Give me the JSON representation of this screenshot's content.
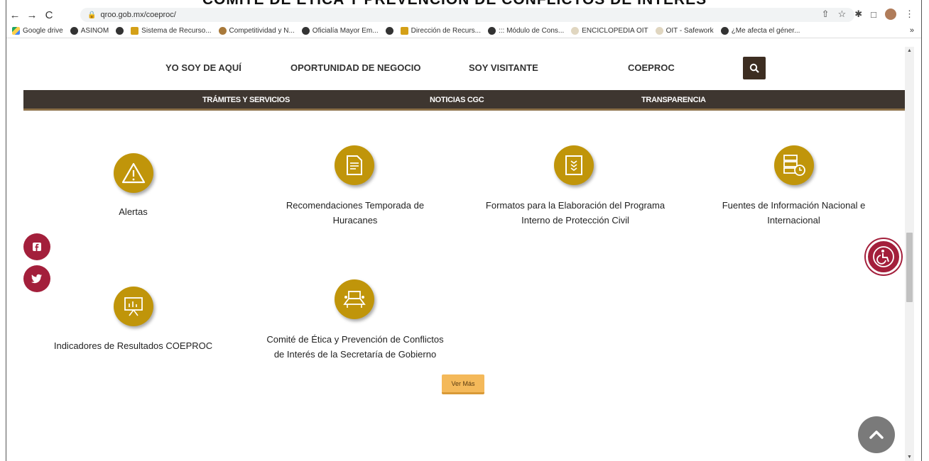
{
  "browser": {
    "url": "qroo.gob.mx/coeproc/",
    "bookmarks": [
      {
        "label": "Google drive",
        "icon": "drive"
      },
      {
        "label": "ASINOM",
        "icon": "globe"
      },
      {
        "label": "",
        "icon": "globe"
      },
      {
        "label": "Sistema de Recurso...",
        "icon": "yel"
      },
      {
        "label": "Competitividad y N...",
        "icon": "brown"
      },
      {
        "label": "Oficialía Mayor Em...",
        "icon": "globe"
      },
      {
        "label": "",
        "icon": "globe"
      },
      {
        "label": "Dirección de Recurs...",
        "icon": "yel"
      },
      {
        "label": "::: Módulo de Cons...",
        "icon": "globe"
      },
      {
        "label": "ENCICLOPEDIA OIT",
        "icon": "light"
      },
      {
        "label": "OIT - Safework",
        "icon": "light"
      },
      {
        "label": "¿Me afecta el géner...",
        "icon": "globe"
      }
    ],
    "more_bookmarks": "»"
  },
  "page_title_cut": "COMITÉ DE ÉTICA Y PREVENCIÓN DE CONFLICTOS DE INTERÉS",
  "top_nav": {
    "yo_soy": "YO SOY DE AQUÍ",
    "oportunidad": "OPORTUNIDAD DE NEGOCIO",
    "visitante": "SOY VISITANTE",
    "coeproc": "COEPROC"
  },
  "sub_nav": {
    "tramites": "TRÁMITES Y SERVICIOS",
    "noticias": "NOTICIAS CGC",
    "transparencia": "TRANSPARENCIA"
  },
  "cards": {
    "alertas": "Alertas",
    "huracanes_1": "Recomendaciones Temporada de",
    "huracanes_2": "Huracanes",
    "formatos_1": "Formatos para la Elaboración del Programa",
    "formatos_2": "Interno de Protección Civil",
    "fuentes_1": "Fuentes de Información Nacional e",
    "fuentes_2": "Internacional",
    "indicadores": "Indicadores de Resultados COEPROC",
    "comite_1": "Comité de Ética y Prevención de Conflictos",
    "comite_2": "de Interés de la Secretaría de Gobierno"
  },
  "ver_mas": "Ver Más",
  "colors": {
    "accent_gold": "#c0950a",
    "nav_dark": "#3e3630",
    "social_red": "#a31f3b",
    "button_orange": "#f4b95a"
  }
}
